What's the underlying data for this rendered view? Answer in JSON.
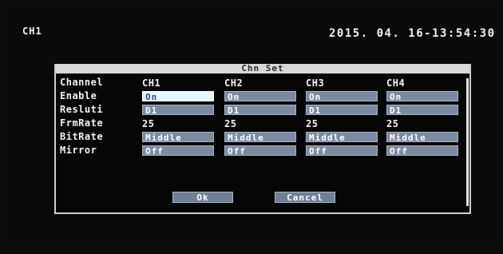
{
  "osd": {
    "channel": "CH1",
    "datetime": "2015. 04. 16-13:54:30"
  },
  "dialog": {
    "title": "Chn Set",
    "row_labels": [
      "Channel",
      "Enable",
      "Resluti",
      "FrmRate",
      "BitRate",
      "Mirror"
    ],
    "columns": [
      "CH1",
      "CH2",
      "CH3",
      "CH4"
    ],
    "enable": [
      "On",
      "On",
      "On",
      "On"
    ],
    "resolution": [
      "D1",
      "D1",
      "D1",
      "D1"
    ],
    "frame_rate": [
      "25",
      "25",
      "25",
      "25"
    ],
    "bit_rate": [
      "Middle",
      "Middle",
      "Middle",
      "Middle"
    ],
    "mirror": [
      "Off",
      "Off",
      "Off",
      "Off"
    ],
    "ok_label": "Ok",
    "cancel_label": "Cancel"
  },
  "colors": {
    "field": "#7b8aa0",
    "field_selected": "#e8f6ff",
    "background": "#0a0a0a",
    "title_bar": "#d9d9d9"
  }
}
